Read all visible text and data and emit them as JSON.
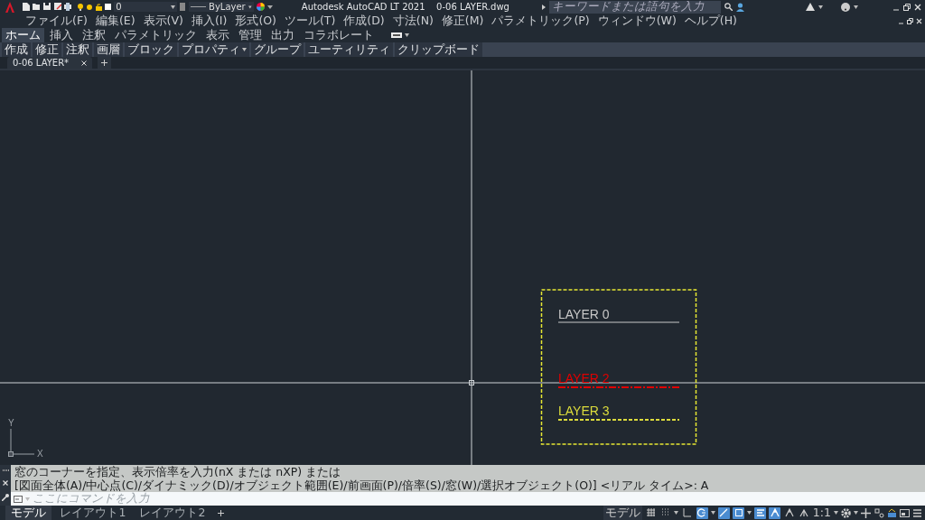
{
  "app": {
    "title": "Autodesk AutoCAD LT 2021",
    "document": "0-06 LAYER.dwg"
  },
  "quick_access": {
    "layer": "0",
    "linetype": "ByLayer"
  },
  "search": {
    "placeholder": "キーワードまたは語句を入力"
  },
  "menu": [
    "ファイル(F)",
    "編集(E)",
    "表示(V)",
    "挿入(I)",
    "形式(O)",
    "ツール(T)",
    "作成(D)",
    "寸法(N)",
    "修正(M)",
    "パラメトリック(P)",
    "ウィンドウ(W)",
    "ヘルプ(H)"
  ],
  "ribbon_tabs": [
    {
      "label": "ホーム",
      "selected": true
    },
    {
      "label": "挿入",
      "selected": false
    },
    {
      "label": "注釈",
      "selected": false
    },
    {
      "label": "パラメトリック",
      "selected": false
    },
    {
      "label": "表示",
      "selected": false
    },
    {
      "label": "管理",
      "selected": false
    },
    {
      "label": "出力",
      "selected": false
    },
    {
      "label": "コラボレート",
      "selected": false
    }
  ],
  "ribbon_panels": [
    {
      "label": "作成"
    },
    {
      "label": "修正"
    },
    {
      "label": "注釈"
    },
    {
      "label": "画層"
    },
    {
      "label": "ブロック"
    },
    {
      "label": "プロパティ",
      "kind": "dropdown"
    },
    {
      "label": "グループ"
    },
    {
      "label": "ユーティリティ"
    },
    {
      "label": "クリップボード"
    }
  ],
  "file_tabs": [
    {
      "label": "0-06 LAYER*",
      "selected": true
    }
  ],
  "drawing": {
    "layers": [
      {
        "label": "LAYER 0",
        "color": "#c8c8c8",
        "kind": "continuous"
      },
      {
        "label": "LAYER 2",
        "color": "#e00000",
        "kind": "dashdot"
      },
      {
        "label": "LAYER 3",
        "color": "#dcdc3c",
        "kind": "dashed"
      }
    ],
    "axes": {
      "x": "X",
      "y": "Y"
    }
  },
  "command": {
    "history": [
      "窓のコーナーを指定、表示倍率を入力(nX または nXP) または",
      "[図面全体(A)/中心点(C)/ダイナミック(D)/オブジェクト範囲(E)/前画面(P)/倍率(S)/窓(W)/選択オブジェクト(O)] <リアル タイム>: A"
    ],
    "placeholder": "ここにコマンドを入力"
  },
  "layout_tabs": [
    {
      "label": "モデル",
      "selected": true
    },
    {
      "label": "レイアウト1",
      "selected": false
    },
    {
      "label": "レイアウト2",
      "selected": false
    }
  ],
  "status_bar": {
    "mode": "モデル",
    "scale": "1:1",
    "items": [
      {
        "kind": "grid",
        "on": false
      },
      {
        "kind": "snap",
        "on": false
      },
      {
        "kind": "dropdown"
      },
      {
        "kind": "ortho",
        "on": false
      },
      {
        "kind": "polar",
        "on": true
      },
      {
        "kind": "dropdown"
      },
      {
        "kind": "isodraft",
        "on": true
      },
      {
        "kind": "osnap",
        "on": true
      },
      {
        "kind": "dropdown"
      },
      {
        "kind": "lineweight",
        "on": true
      },
      {
        "kind": "annovis",
        "on": true
      },
      {
        "kind": "autoscale",
        "on": false
      },
      {
        "kind": "annoscale",
        "on": false
      }
    ]
  }
}
